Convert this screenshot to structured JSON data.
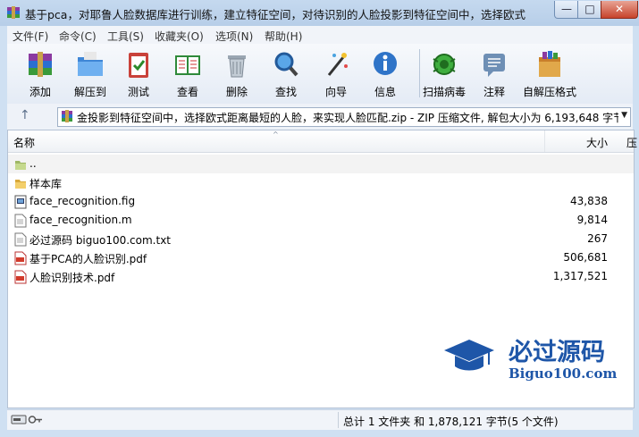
{
  "window": {
    "title": "基于pca，对耶鲁人脸数据库进行训练，建立特征空间，对待识别的人脸投影到特征空间中，选择欧式距...",
    "controls": {
      "minimize": "—",
      "maximize": "□",
      "close": "✕"
    }
  },
  "menu": [
    "文件(F)",
    "命令(C)",
    "工具(S)",
    "收藏夹(O)",
    "选项(N)",
    "帮助(H)"
  ],
  "toolbar": {
    "add": "添加",
    "extract": "解压到",
    "test": "测试",
    "view": "查看",
    "delete": "删除",
    "find": "查找",
    "wizard": "向导",
    "info": "信息",
    "scan": "扫描病毒",
    "comment": "注释",
    "sfx": "自解压格式"
  },
  "address": {
    "up_arrow": "↑",
    "path": "金投影到特征空间中，选择欧式距离最短的人脸，来实现人脸匹配.zip - ZIP 压缩文件, 解包大小为 6,193,648 字节",
    "dropdown_arrow": "▼"
  },
  "columns": {
    "name": "名称",
    "size": "大小",
    "packed": "压",
    "sort_arrow": "^"
  },
  "files": [
    {
      "name": "..",
      "size": "",
      "icon": "folder-up-icon"
    },
    {
      "name": "样本库",
      "size": "",
      "icon": "folder-icon"
    },
    {
      "name": "face_recognition.fig",
      "size": "43,838",
      "icon": "fig-file-icon"
    },
    {
      "name": "face_recognition.m",
      "size": "9,814",
      "icon": "text-file-icon"
    },
    {
      "name": "必过源码 biguo100.com.txt",
      "size": "267",
      "icon": "text-file-icon"
    },
    {
      "name": "基于PCA的人脸识别.pdf",
      "size": "506,681",
      "icon": "pdf-file-icon"
    },
    {
      "name": "人脸识别技术.pdf",
      "size": "1,317,521",
      "icon": "pdf-file-icon"
    }
  ],
  "watermark": {
    "line1": "必过源码",
    "line2": "Biguo100.com"
  },
  "status": {
    "summary": "总计 1 文件夹 和 1,878,121 字节(5 个文件)"
  },
  "colors": {
    "title_bg": "#c5d9ef",
    "close_red": "#c7432b",
    "watermark_blue": "#1e56a8"
  }
}
